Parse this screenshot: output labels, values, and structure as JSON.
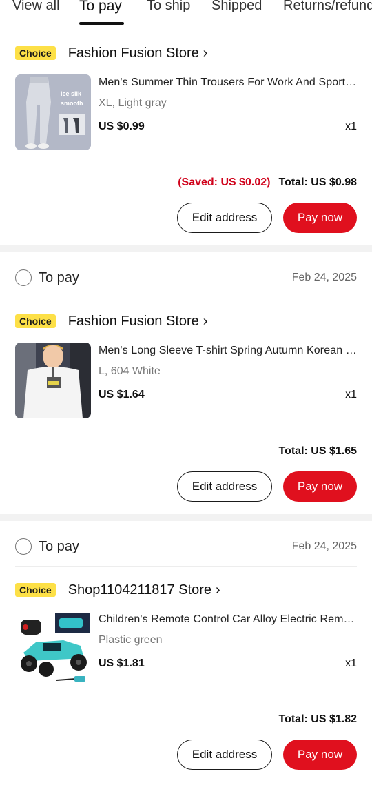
{
  "tabs": [
    {
      "label": "View all"
    },
    {
      "label": "To pay"
    },
    {
      "label": "To ship"
    },
    {
      "label": "Shipped"
    },
    {
      "label": "Returns/refund"
    }
  ],
  "orders": [
    {
      "badge": "Choice",
      "store": "Fashion Fusion Store",
      "product": {
        "title": "Men's Summer Thin Trousers For Work And Sports Casual Pants",
        "variant": "XL, Light gray",
        "price": "US $0.99",
        "qty": "x1",
        "thumb_text_1": "Ice silk",
        "thumb_text_2": "smooth"
      },
      "saved": "(Saved: US $0.02)",
      "total": "Total: US $0.98",
      "edit_label": "Edit address",
      "pay_label": "Pay now"
    },
    {
      "status": "To pay",
      "date": "Feb 24, 2025",
      "badge": "Choice",
      "store": "Fashion Fusion Store",
      "product": {
        "title": "Men's Long Sleeve T-shirt Spring Autumn Korean Style Top",
        "variant": "L, 604 White",
        "price": "US $1.64",
        "qty": "x1"
      },
      "total": "Total: US $1.65",
      "edit_label": "Edit address",
      "pay_label": "Pay now"
    },
    {
      "status": "To pay",
      "date": "Feb 24, 2025",
      "badge": "Choice",
      "store": "Shop1104211817 Store",
      "product": {
        "title": "Children's Remote Control Car Alloy Electric Remote Racing Car",
        "variant": "Plastic green",
        "price": "US $1.81",
        "qty": "x1"
      },
      "total": "Total: US $1.82",
      "edit_label": "Edit address",
      "pay_label": "Pay now"
    }
  ],
  "colors": {
    "accent_red": "#e0101e",
    "saved_red": "#d0021b",
    "choice_yellow": "#fde047"
  }
}
